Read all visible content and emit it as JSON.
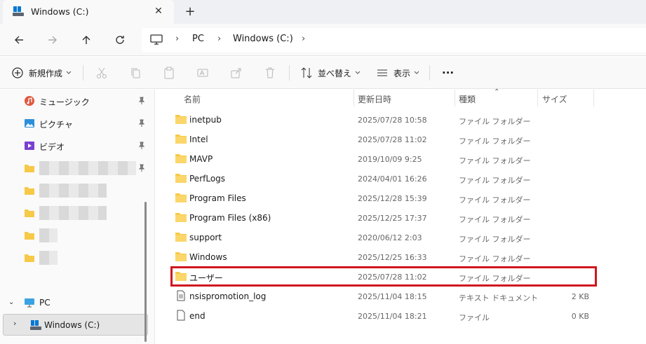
{
  "tab": {
    "title": "Windows (C:)",
    "close": "✕",
    "new": "+"
  },
  "breadcrumb": [
    "PC",
    "Windows (C:)"
  ],
  "commands": {
    "new": "新規作成",
    "sort": "並べ替え",
    "view": "表示",
    "more": "···"
  },
  "nav": {
    "quick": [
      {
        "label": "ミュージック",
        "icon": "music-icon"
      },
      {
        "label": "ピクチャ",
        "icon": "pictures-icon"
      },
      {
        "label": "ビデオ",
        "icon": "videos-icon"
      }
    ],
    "pc_label": "PC",
    "drive_label": "Windows (C:)"
  },
  "columns": {
    "name": "名前",
    "date": "更新日時",
    "type": "種類",
    "size": "サイズ"
  },
  "files": [
    {
      "name": "inetpub",
      "date": "2025/07/28 10:58",
      "type": "ファイル フォルダー",
      "size": "",
      "icon": "folder-icon"
    },
    {
      "name": "Intel",
      "date": "2025/07/28 11:02",
      "type": "ファイル フォルダー",
      "size": "",
      "icon": "folder-icon"
    },
    {
      "name": "MAVP",
      "date": "2019/10/09 9:25",
      "type": "ファイル フォルダー",
      "size": "",
      "icon": "folder-icon"
    },
    {
      "name": "PerfLogs",
      "date": "2024/04/01 16:26",
      "type": "ファイル フォルダー",
      "size": "",
      "icon": "folder-icon"
    },
    {
      "name": "Program Files",
      "date": "2025/12/28 15:39",
      "type": "ファイル フォルダー",
      "size": "",
      "icon": "folder-icon"
    },
    {
      "name": "Program Files (x86)",
      "date": "2025/12/25 17:37",
      "type": "ファイル フォルダー",
      "size": "",
      "icon": "folder-icon"
    },
    {
      "name": "support",
      "date": "2020/06/12 2:03",
      "type": "ファイル フォルダー",
      "size": "",
      "icon": "folder-icon"
    },
    {
      "name": "Windows",
      "date": "2025/12/25 16:33",
      "type": "ファイル フォルダー",
      "size": "",
      "icon": "folder-icon"
    },
    {
      "name": "ユーザー",
      "date": "2025/07/28 11:02",
      "type": "ファイル フォルダー",
      "size": "",
      "icon": "folder-icon"
    },
    {
      "name": "nsispromotion_log",
      "date": "2025/11/04 18:15",
      "type": "テキスト ドキュメント",
      "size": "2 KB",
      "icon": "text-file-icon"
    },
    {
      "name": "end",
      "date": "2025/11/04 18:21",
      "type": "ファイル",
      "size": "0 KB",
      "icon": "file-icon"
    }
  ],
  "colors": {
    "highlight": "#d0161f",
    "folder": "#f7c948",
    "accent": "#0067c0"
  }
}
